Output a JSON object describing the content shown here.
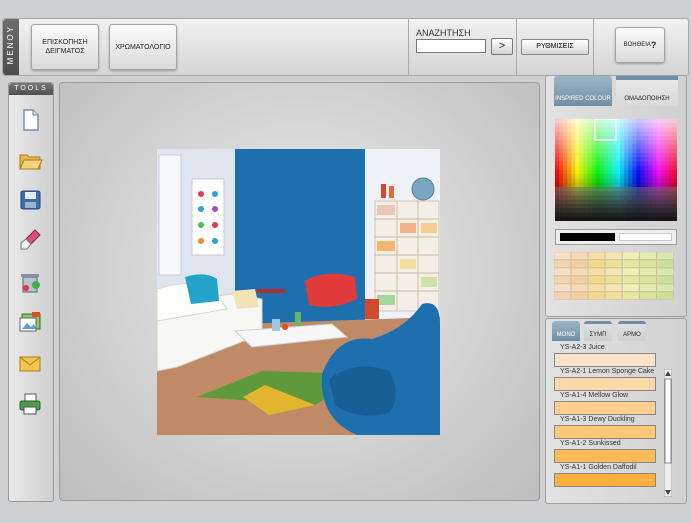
{
  "topbar": {
    "menu_tab_label": "MENOY",
    "btn_browse": "ΕΠΙΣΚΟΠΗΣΗ ΔΕΙΓΜΑΤΟΣ",
    "btn_colormap": "ΧΡΩΜΑΤΟΛΟΓΙΟ",
    "search_label": "ΑΝΑΖΗΤΗΣΗ",
    "search_value": "",
    "search_go": ">",
    "settings_label": "ΡΥΘΜΙΣΕΙΣ",
    "help_label": "ΒΟΗΘΕΙΑ",
    "help_symbol": "?"
  },
  "tools": {
    "header": "TOOLS",
    "items": [
      "new-document-icon",
      "open-folder-icon",
      "save-disk-icon",
      "paint-brush-icon",
      "recycle-bin-icon",
      "gallery-images-icon",
      "email-envelope-icon",
      "print-icon"
    ]
  },
  "palette": {
    "tab_inspired": "INSPIRED COLOUR",
    "tab_group": "ΟΜΑΔΟΠΟΙΗΣΗ",
    "selected_dark": "#000000",
    "selected_light": "#ffffff"
  },
  "mono": {
    "tab_mono": "MONO",
    "tab_symp": "ΣΥΜΠ",
    "tab_harm": "ΑΡΜΟ",
    "colors": [
      {
        "name": "YS-A2-3 Juice",
        "hex": "#fde3c6"
      },
      {
        "name": "YS-A2-1 Lemon Sponge Cake",
        "hex": "#fdd9a8"
      },
      {
        "name": "YS-A1-4 Mellow Glow",
        "hex": "#fcd08e"
      },
      {
        "name": "YS-A1-3 Dewy Duckling",
        "hex": "#fbc774"
      },
      {
        "name": "YS-A1-2 Sunkissed",
        "hex": "#f9bb58"
      },
      {
        "name": "YS-A1-1 Golden Daffodil",
        "hex": "#f8b13f"
      }
    ]
  },
  "colors": {
    "accent_blue": "#6f8ea5",
    "room_wall": "#1d6fae"
  }
}
